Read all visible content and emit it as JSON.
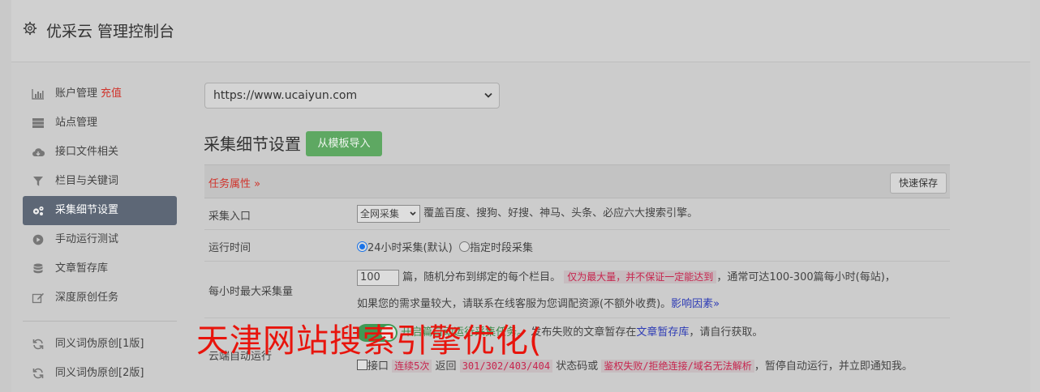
{
  "header": {
    "title": "优采云 管理控制台",
    "icon": "gear-icon"
  },
  "sidebar": {
    "items": [
      {
        "label": "账户管理",
        "badge": "充值",
        "icon": "bar-chart-icon"
      },
      {
        "label": "站点管理",
        "icon": "server-icon"
      },
      {
        "label": "接口文件相关",
        "icon": "cloud-download-icon"
      },
      {
        "label": "栏目与关键词",
        "icon": "filter-icon"
      },
      {
        "label": "采集细节设置",
        "icon": "gears-icon",
        "active": true
      },
      {
        "label": "手动运行测试",
        "icon": "play-circle-icon"
      },
      {
        "label": "文章暂存库",
        "icon": "database-icon"
      },
      {
        "label": "深度原创任务",
        "icon": "edit-icon"
      }
    ],
    "items2": [
      {
        "label": "同义词伪原创[1版]",
        "icon": "refresh-icon"
      },
      {
        "label": "同义词伪原创[2版]",
        "icon": "refresh-icon"
      }
    ]
  },
  "site_select": {
    "value": "https://www.ucaiyun.com"
  },
  "section": {
    "title": "采集细节设置",
    "import_label": "从模板导入"
  },
  "table": {
    "header_label": "任务属性 »",
    "quick_save": "快速保存",
    "rows": {
      "entry": {
        "label": "采集入口",
        "select": "全网采集",
        "desc": "覆盖百度、搜狗、好搜、神马、头条、必应六大搜索引擎。"
      },
      "time": {
        "label": "运行时间",
        "opt1": "24小时采集(默认)",
        "opt2": "指定时段采集"
      },
      "max": {
        "label": "每小时最大采集量",
        "value": "100",
        "text1": "篇，随机分布到绑定的每个栏目。",
        "warn": "仅为最大量，并不保证一定能达到",
        "text2": "，通常可达100-300篇每小时(每站)，",
        "line2": "如果您的需求量较大，请联系在线客服为您调配资源(不额外收费)。",
        "link": "影响因素»"
      },
      "cloud": {
        "label": "云端自动运行",
        "line1a": "开启",
        "line1b": "篇自动运行采集任务。",
        "line1c": "发布失败的文章暂存在",
        "line1link": "文章暂存库",
        "line1d": "，请自行获取。",
        "l2a": "接口",
        "l2code1": "连续5次",
        "l2b": "返回",
        "l2code2": "301/302/403/404",
        "l2c": "状态码或",
        "l2code3": "鉴权失败/拒绝连接/域名无法解析",
        "l2d": "，暂停自动运行，并立即通知我。"
      }
    }
  },
  "overlay_text": "天津网站搜索引擎优化("
}
